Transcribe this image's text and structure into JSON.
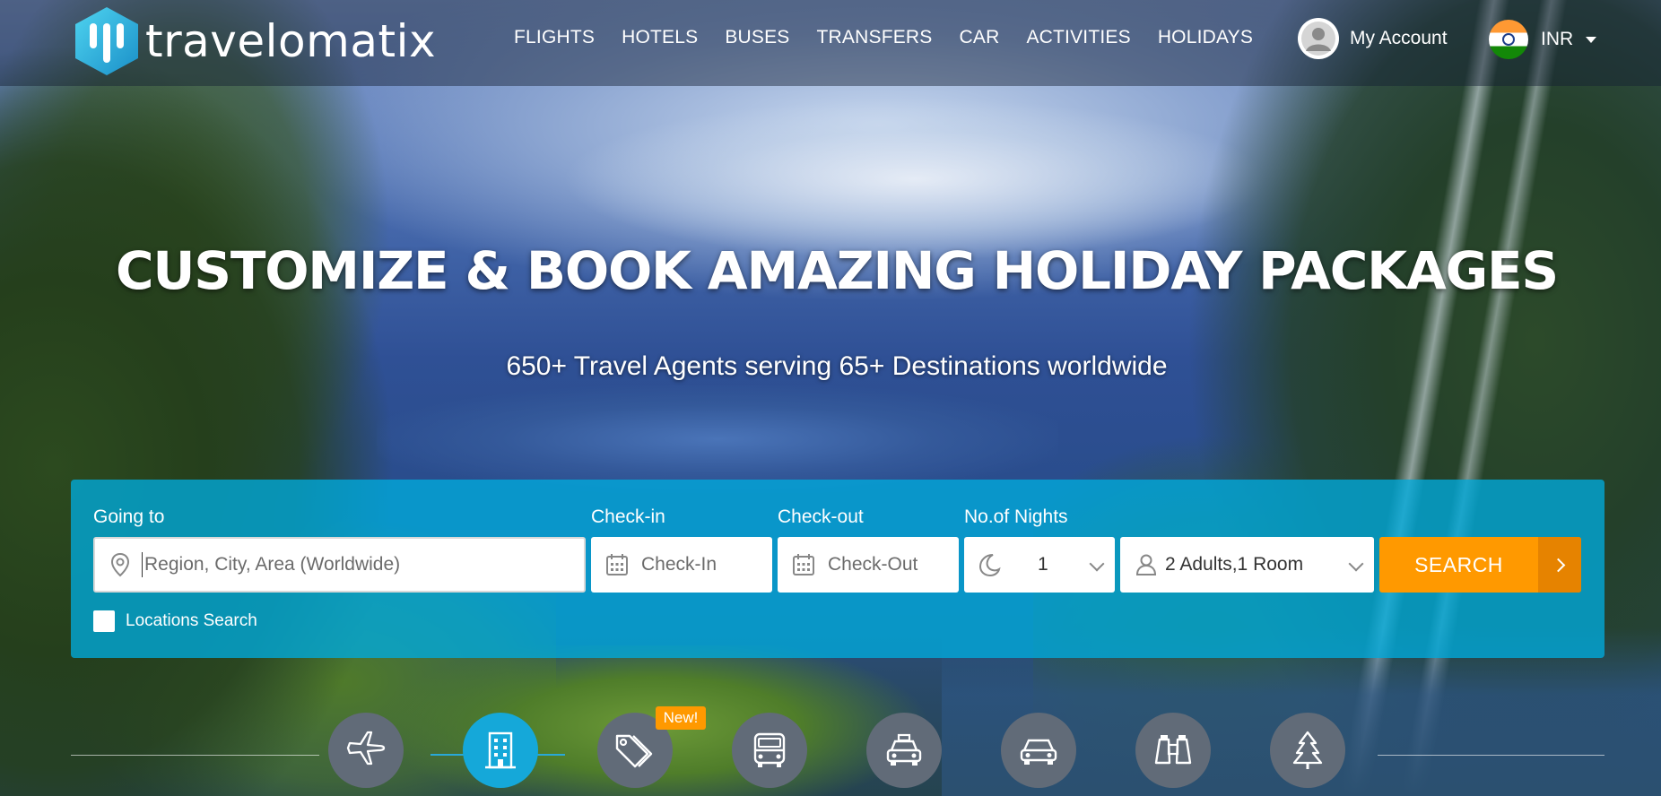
{
  "brand": {
    "name": "travelomatix"
  },
  "nav": {
    "items": [
      "FLIGHTS",
      "HOTELS",
      "BUSES",
      "TRANSFERS",
      "CAR",
      "ACTIVITIES",
      "HOLIDAYS"
    ]
  },
  "account": {
    "label": "My Account",
    "icon": "user-avatar-icon"
  },
  "currency": {
    "code": "INR",
    "flag": "india-flag"
  },
  "hero": {
    "title": "CUSTOMIZE & BOOK AMAZING HOLIDAY PACKAGES",
    "subtitle": "650+ Travel Agents serving 65+ Destinations worldwide"
  },
  "search": {
    "going_to": {
      "label": "Going to",
      "placeholder": "Region, City, Area (Worldwide)",
      "icon": "map-pin-icon"
    },
    "check_in": {
      "label": "Check-in",
      "placeholder": "Check-In",
      "icon": "calendar-icon"
    },
    "check_out": {
      "label": "Check-out",
      "placeholder": "Check-Out",
      "icon": "calendar-icon"
    },
    "nights": {
      "label": "No.of Nights",
      "value": "1",
      "icon": "moon-icon"
    },
    "guests": {
      "value": "2 Adults,1 Room",
      "icon": "person-icon"
    },
    "button": {
      "label": "SEARCH"
    },
    "locations_search": {
      "label": "Locations Search",
      "checked": false
    }
  },
  "services": {
    "badge_new": "New!",
    "items": [
      {
        "name": "flights",
        "icon": "airplane-icon",
        "active": false
      },
      {
        "name": "hotels",
        "icon": "building-icon",
        "active": true
      },
      {
        "name": "deals",
        "icon": "price-tags-icon",
        "active": false,
        "badge": "New!"
      },
      {
        "name": "buses",
        "icon": "bus-icon",
        "active": false
      },
      {
        "name": "transfers",
        "icon": "taxi-icon",
        "active": false
      },
      {
        "name": "car",
        "icon": "car-icon",
        "active": false
      },
      {
        "name": "activities",
        "icon": "binoculars-icon",
        "active": false
      },
      {
        "name": "holidays",
        "icon": "tree-icon",
        "active": false
      }
    ]
  },
  "colors": {
    "accent": "#15a8d9",
    "search_button": "#ff9900",
    "panel": "#00aadc",
    "icon_bg": "#616b78"
  }
}
